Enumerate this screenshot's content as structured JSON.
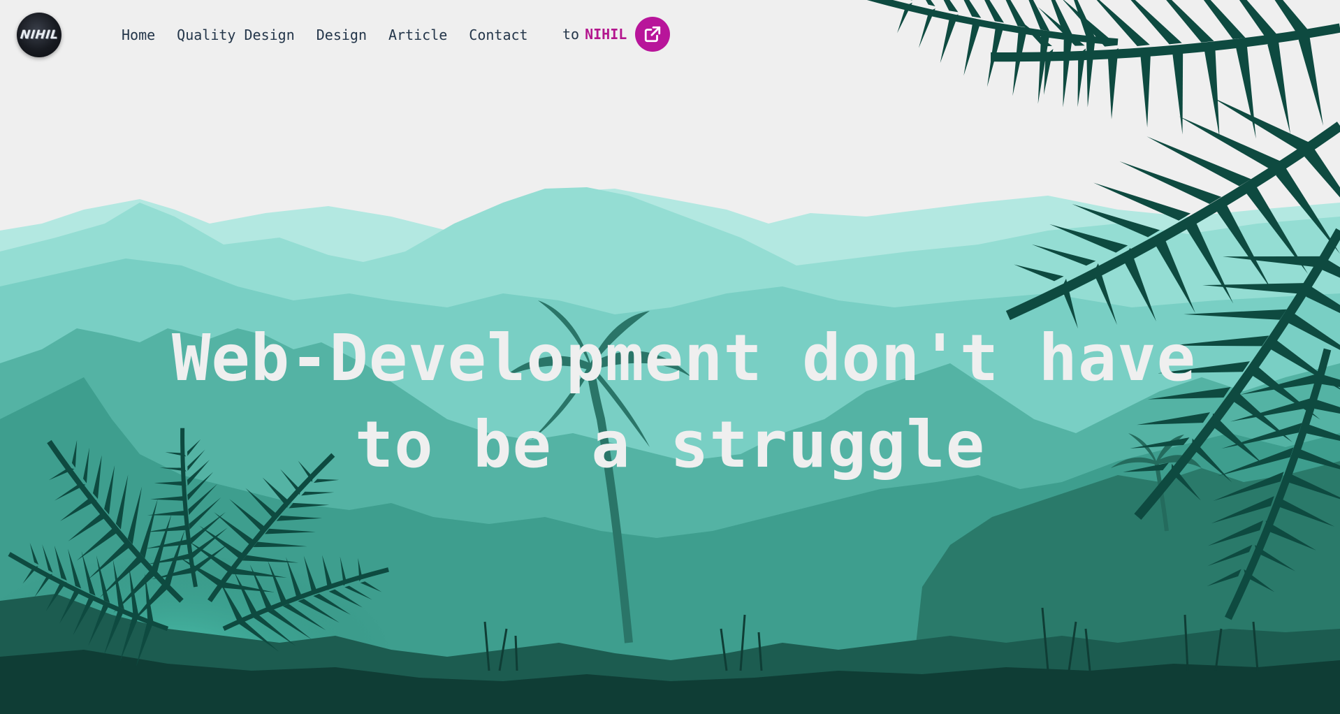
{
  "logo": {
    "text": "NIHIL"
  },
  "nav": {
    "items": [
      {
        "label": "Home"
      },
      {
        "label": "Quality Design"
      },
      {
        "label": "Design"
      },
      {
        "label": "Article"
      },
      {
        "label": "Contact"
      }
    ]
  },
  "brand": {
    "prefix": "to",
    "name": "NIHIL",
    "icon": "external-link-icon"
  },
  "hero": {
    "line1": "Web-Development don't have",
    "line2": "to be a struggle"
  },
  "colors": {
    "background": "#efefef",
    "nav_text": "#24364a",
    "brand_accent": "#b3168e",
    "cta_button": "#b8159a",
    "hero_text": "#efefef",
    "jungle_light": "#b3e8e1",
    "jungle_mid": "#5fbfb1",
    "jungle_dark": "#0f3d35"
  }
}
